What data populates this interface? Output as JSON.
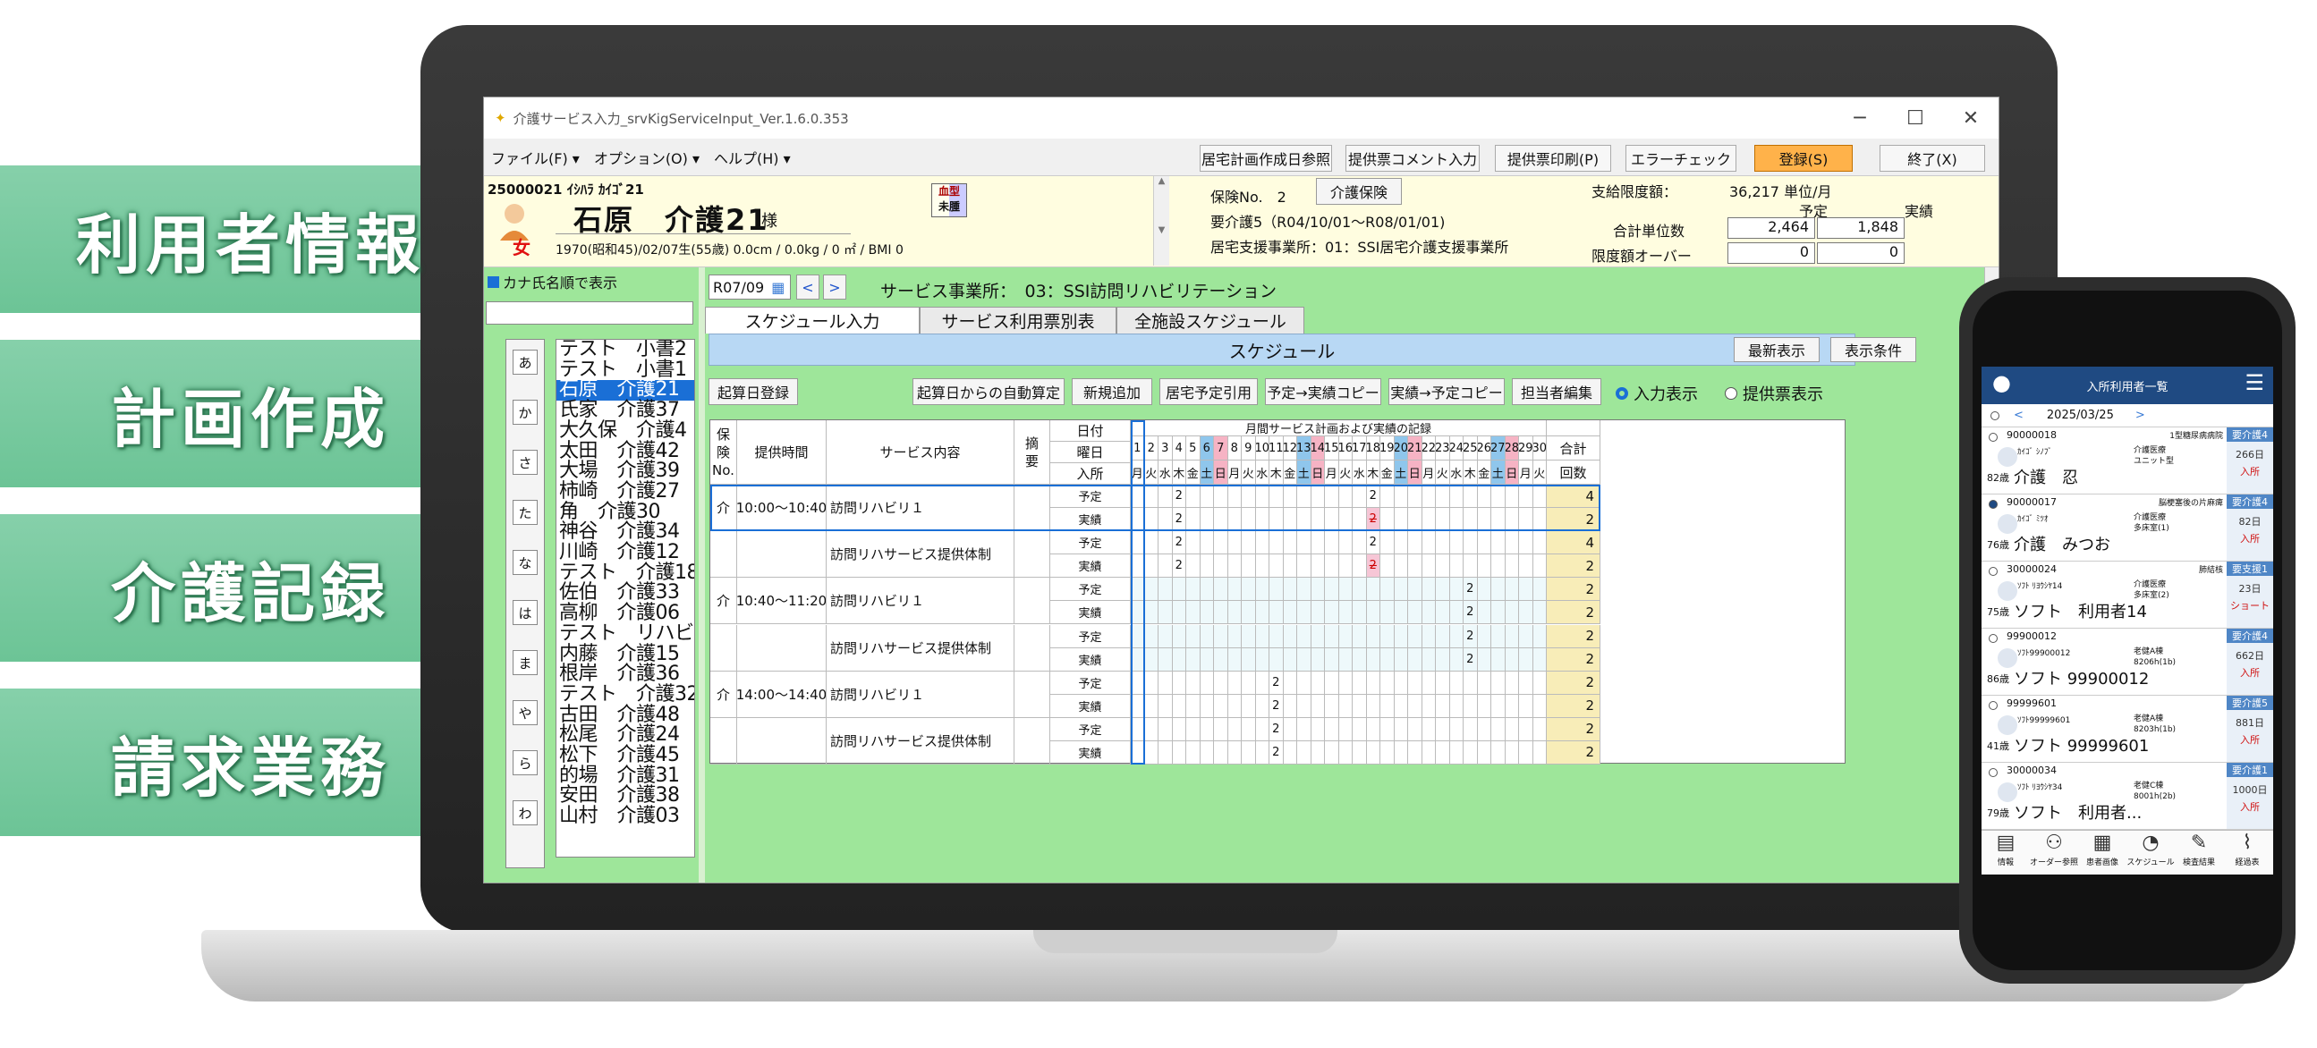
{
  "ribbons": [
    "利用者情報",
    "計画作成",
    "介護記録",
    "請求業務"
  ],
  "window": {
    "title": "介護サービス入力_srvKigServiceInput_Ver.1.6.0.353",
    "controls": [
      "─",
      "☐",
      "✕"
    ]
  },
  "menu": [
    "ファイル(F) ▾",
    "オプション(O) ▾",
    "ヘルプ(H) ▾"
  ],
  "toolbar": [
    "居宅計画作成日参照",
    "提供票コメント入力",
    "提供票印刷(P)",
    "エラーチェック",
    "登録(S)",
    "終了(X)"
  ],
  "user": {
    "id_kana": "25000021 ｲｼﾊﾗ ｶｲｺﾞ21",
    "name": "石原　介護21",
    "honorific": "様",
    "gender": "女",
    "details": "1970(昭和45)/02/07生(55歳)  0.0cm / 0.0kg / 0 ㎡ / BMI 0",
    "badge1": "血型",
    "badge2": "未腫",
    "insurance_label": "保険No.　2",
    "insurance_button": "介護保険",
    "care_level": "要介護5（R04/10/01～R08/01/01)",
    "support_office": "居宅支援事業所：01：SSI居宅介護支援事業所",
    "limit_label": "支給限度額：",
    "limit_value": "36,217 単位/月",
    "col_plan": "予定",
    "col_actual": "実績",
    "total_units_label": "合計単位数",
    "total_plan": "2,464",
    "total_actual": "1,848",
    "over_label": "限度額オーバー",
    "over_plan": "0",
    "over_actual": "0"
  },
  "left": {
    "sort_label": "カナ氏名順で表示",
    "kana": [
      "あ",
      "か",
      "さ",
      "た",
      "な",
      "は",
      "ま",
      "や",
      "ら",
      "わ"
    ],
    "names": [
      "テスト　小書2",
      "テスト　小書1",
      "石原　介護21",
      "氏家　介護37",
      "大久保　介護4",
      "太田　介護42",
      "大場　介護39",
      "柿崎　介護27",
      "角　介護30",
      "神谷　介護34",
      "川崎　介護12",
      "テスト　介護18",
      "佐伯　介護33",
      "高柳　介護06",
      "テスト　リハビリ",
      "内藤　介護15",
      "根岸　介護36",
      "テスト　介護32",
      "古田　介護48",
      "松尾　介護24",
      "松下　介護45",
      "的場　介護31",
      "安田　介護38",
      "山村　介護03"
    ],
    "selected_index": 2
  },
  "main": {
    "month": "R07/09",
    "provider": "サービス事業所：　03：SSI訪問リハビリテーション",
    "tabs": [
      "スケジュール入力",
      "サービス利用票別表",
      "全施設スケジュール"
    ],
    "schedule_label": "スケジュール",
    "refresh_button": "最新表示",
    "display_cond_button": "表示条件",
    "buttons": [
      "起算日登録",
      "起算日からの自動算定",
      "新規追加",
      "居宅予定引用",
      "予定→実績コピー",
      "実績→予定コピー",
      "担当者編集"
    ],
    "radio_input": "入力表示",
    "radio_provide": "提供票表示"
  },
  "grid": {
    "headers": {
      "hoken": "保\n険\nNo.",
      "time": "提供時間",
      "service": "サービス内容",
      "summary": "摘\n要",
      "date": "日付",
      "weekday": "曜日",
      "entry": "入所",
      "monthly": "月間サービス計画および実績の記録",
      "total": "合計",
      "count": "回数"
    },
    "days": [
      "1",
      "2",
      "3",
      "4",
      "5",
      "6",
      "7",
      "8",
      "9",
      "10",
      "11",
      "12",
      "13",
      "14",
      "15",
      "16",
      "17",
      "18",
      "19",
      "20",
      "21",
      "22",
      "23",
      "24",
      "25",
      "26",
      "27",
      "28",
      "29",
      "30"
    ],
    "weekdays": [
      "月",
      "火",
      "水",
      "木",
      "金",
      "土",
      "日",
      "月",
      "火",
      "水",
      "木",
      "金",
      "土",
      "日",
      "月",
      "火",
      "水",
      "木",
      "金",
      "土",
      "日",
      "月",
      "火",
      "水",
      "木",
      "金",
      "土",
      "日",
      "月",
      "火"
    ],
    "rows": [
      {
        "hoken": "介",
        "time": "10:00～10:40",
        "service": "訪問リハビリ１",
        "type": "予定",
        "marks": {
          "4": "2",
          "18": "2"
        },
        "total": "4"
      },
      {
        "hoken": "",
        "time": "",
        "service": "",
        "type": "実績",
        "marks": {
          "4": "2",
          "18": "2̶"
        },
        "total": "2"
      },
      {
        "hoken": "",
        "time": "",
        "service": "訪問リハサービス提供体制",
        "type": "予定",
        "marks": {
          "4": "2",
          "18": "2"
        },
        "total": "4"
      },
      {
        "hoken": "",
        "time": "",
        "service": "",
        "type": "実績",
        "marks": {
          "4": "2",
          "18": "2̶"
        },
        "total": "2"
      },
      {
        "hoken": "介",
        "time": "10:40～11:20",
        "service": "訪問リハビリ１",
        "type": "予定",
        "marks": {
          "25": "2"
        },
        "total": "2"
      },
      {
        "hoken": "",
        "time": "",
        "service": "",
        "type": "実績",
        "marks": {
          "25": "2"
        },
        "total": "2"
      },
      {
        "hoken": "",
        "time": "",
        "service": "訪問リハサービス提供体制",
        "type": "予定",
        "marks": {
          "25": "2"
        },
        "total": "2"
      },
      {
        "hoken": "",
        "time": "",
        "service": "",
        "type": "実績",
        "marks": {
          "25": "2"
        },
        "total": "2"
      },
      {
        "hoken": "介",
        "time": "14:00～14:40",
        "service": "訪問リハビリ１",
        "type": "予定",
        "marks": {
          "11": "2"
        },
        "total": "2"
      },
      {
        "hoken": "",
        "time": "",
        "service": "",
        "type": "実績",
        "marks": {
          "11": "2"
        },
        "total": "2"
      },
      {
        "hoken": "",
        "time": "",
        "service": "訪問リハサービス提供体制",
        "type": "予定",
        "marks": {
          "11": "2"
        },
        "total": "2"
      },
      {
        "hoken": "",
        "time": "",
        "service": "",
        "type": "実績",
        "marks": {
          "11": "2"
        },
        "total": "2"
      }
    ]
  },
  "phone": {
    "title": "入所利用者一覧",
    "date": "2025/03/25",
    "residents": [
      {
        "id": "90000018",
        "kana": "ｶｲｺﾞ ｼﾉﾌﾞ",
        "age": "82歳",
        "name": "介護　忍",
        "ward": "1型糖尿病病院",
        "care": "要介護4",
        "room": "介護医療\nユニット型",
        "days": "266日",
        "status": "入所"
      },
      {
        "id": "90000017",
        "kana": "ｶｲｺﾞ ﾐﾂｵ",
        "age": "76歳",
        "name": "介護　みつお",
        "ward": "脳梗塞後の片麻痺",
        "care": "要介護4",
        "room": "介護医療\n多床室(1)",
        "days": "82日",
        "status": "入所"
      },
      {
        "id": "30000024",
        "kana": "ｿﾌﾄ ﾘﾖｳｼﾔ14",
        "age": "75歳",
        "name": "ソフト　利用者14",
        "ward": "肺結核",
        "care": "要支援1",
        "room": "介護医療\n多床室(2)",
        "days": "23日",
        "status": "ショート"
      },
      {
        "id": "99900012",
        "kana": "ｿﾌﾄ99900012",
        "age": "86歳",
        "name": "ソフト 99900012",
        "ward": "",
        "care": "要介護4",
        "room": "老健A棟\n8206h(1b)",
        "days": "662日",
        "status": "入所"
      },
      {
        "id": "99999601",
        "kana": "ｿﾌﾄ99999601",
        "age": "41歳",
        "name": "ソフト 99999601",
        "ward": "",
        "care": "要介護5",
        "room": "老健A棟\n8203h(1b)",
        "days": "881日",
        "status": "入所"
      },
      {
        "id": "30000034",
        "kana": "ｿﾌﾄ ﾘﾖｳｼﾔ34",
        "age": "79歳",
        "name": "ソフト　利用者...",
        "ward": "",
        "care": "要介護1",
        "room": "老健C棟\n8001h(2b)",
        "days": "1000日",
        "status": "入所"
      }
    ],
    "nav": [
      "情報",
      "オーダー参照",
      "患者画像",
      "スケジュール",
      "検査結果",
      "経過表"
    ]
  }
}
